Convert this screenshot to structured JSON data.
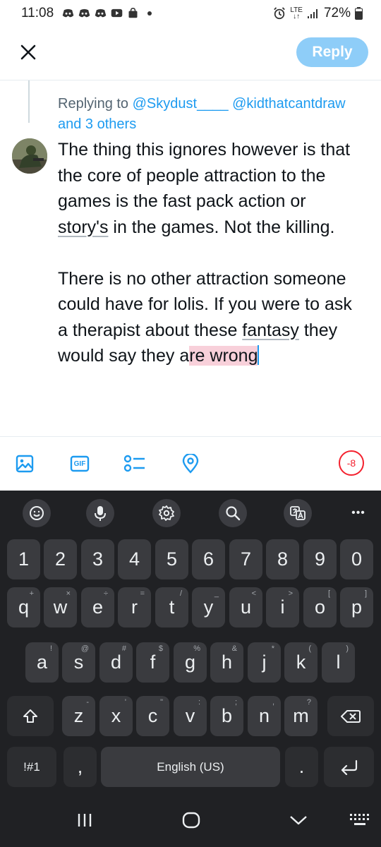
{
  "status_bar": {
    "time": "11:08",
    "network": "LTE",
    "battery": "72%",
    "notification_icons": [
      "discord-icon",
      "discord-icon",
      "discord-icon",
      "youtube-icon",
      "bag-icon"
    ]
  },
  "header": {
    "reply_label": "Reply"
  },
  "replying": {
    "prefix": "Replying to",
    "user1": "@Skydust____",
    "user2": "@kidthatcantdraw",
    "others": "and 3 others"
  },
  "tweet": {
    "p1": {
      "line1": "The thing this ignores however is that",
      "line2": "the core of people attraction to the",
      "line3": "games is the fast pack action or",
      "line4_underlined": "story's",
      "line4_rest": " in the games. Not the killing."
    },
    "p2": {
      "line1": "There is no other attraction someone",
      "line2": "could have for lolis. If you were to ask",
      "line3_a": "a therapist about these ",
      "line3_underlined": "fantasy",
      "line3_b": " they",
      "line4_a": "would say they a",
      "line4_highlight": "re wrong"
    }
  },
  "toolbar": {
    "icons": [
      "image-icon",
      "gif-icon",
      "poll-icon",
      "location-icon"
    ],
    "gif_label": "GIF",
    "char_counter": "-8"
  },
  "keyboard": {
    "toolbar_icons": [
      "emoji-icon",
      "microphone-icon",
      "settings-icon",
      "search-icon",
      "translate-icon",
      "more-icon"
    ],
    "more_label": "•••",
    "row1": [
      "1",
      "2",
      "3",
      "4",
      "5",
      "6",
      "7",
      "8",
      "9",
      "0"
    ],
    "row2": [
      {
        "key": "q",
        "hint": "+"
      },
      {
        "key": "w",
        "hint": "×"
      },
      {
        "key": "e",
        "hint": "÷"
      },
      {
        "key": "r",
        "hint": "="
      },
      {
        "key": "t",
        "hint": "/"
      },
      {
        "key": "y",
        "hint": "_"
      },
      {
        "key": "u",
        "hint": "<"
      },
      {
        "key": "i",
        "hint": ">"
      },
      {
        "key": "o",
        "hint": "["
      },
      {
        "key": "p",
        "hint": "]"
      }
    ],
    "row3": [
      {
        "key": "a",
        "hint": "!"
      },
      {
        "key": "s",
        "hint": "@"
      },
      {
        "key": "d",
        "hint": "#"
      },
      {
        "key": "f",
        "hint": "$"
      },
      {
        "key": "g",
        "hint": "%"
      },
      {
        "key": "h",
        "hint": "&"
      },
      {
        "key": "j",
        "hint": "*"
      },
      {
        "key": "k",
        "hint": "("
      },
      {
        "key": "l",
        "hint": ")"
      }
    ],
    "row4": [
      {
        "key": "z",
        "hint": "-"
      },
      {
        "key": "x",
        "hint": "'"
      },
      {
        "key": "c",
        "hint": "\""
      },
      {
        "key": "v",
        "hint": ":"
      },
      {
        "key": "b",
        "hint": ";"
      },
      {
        "key": "n",
        "hint": ","
      },
      {
        "key": "m",
        "hint": "?"
      }
    ],
    "symbols_label": "!#1",
    "comma": ",",
    "space_label": "English (US)",
    "period": "."
  },
  "nav_bar": {
    "icons": [
      "recent-apps-icon",
      "home-icon",
      "back-icon",
      "keyboard-switch-icon"
    ]
  }
}
